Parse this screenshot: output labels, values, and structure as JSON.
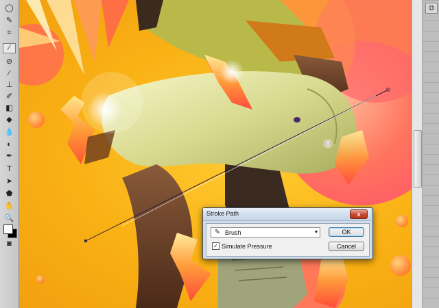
{
  "toolbar": {
    "tools": [
      {
        "id": "lasso",
        "icon": "lasso-icon",
        "glyph": "◯"
      },
      {
        "id": "quick-select",
        "icon": "magic-wand-icon",
        "glyph": "✎"
      },
      {
        "id": "crop",
        "icon": "crop-icon",
        "glyph": "⌗"
      },
      {
        "id": "eyedropper",
        "icon": "eyedropper-icon",
        "glyph": "⁄",
        "active": true
      },
      {
        "id": "healing",
        "icon": "bandage-icon",
        "glyph": "⊘"
      },
      {
        "id": "brush",
        "icon": "brush-icon",
        "glyph": "∕"
      },
      {
        "id": "clone",
        "icon": "stamp-icon",
        "glyph": "⊥"
      },
      {
        "id": "history",
        "icon": "history-brush-icon",
        "glyph": "✐"
      },
      {
        "id": "eraser",
        "icon": "eraser-icon",
        "glyph": "◧"
      },
      {
        "id": "bucket",
        "icon": "paint-bucket-icon",
        "glyph": "◆"
      },
      {
        "id": "blur",
        "icon": "drop-icon",
        "glyph": "💧"
      },
      {
        "id": "dodge",
        "icon": "dodge-icon",
        "glyph": "◐"
      },
      {
        "id": "pen",
        "icon": "pen-icon",
        "glyph": "✒"
      },
      {
        "id": "type",
        "icon": "type-icon",
        "glyph": "T"
      },
      {
        "id": "path-select",
        "icon": "arrow-icon",
        "glyph": "➤"
      },
      {
        "id": "shape",
        "icon": "shape-icon",
        "glyph": "⬟"
      },
      {
        "id": "hand",
        "icon": "hand-icon",
        "glyph": "✋"
      },
      {
        "id": "zoom",
        "icon": "zoom-icon",
        "glyph": "🔍"
      }
    ],
    "mode_icon": "quick-mask-icon"
  },
  "colors": {
    "foreground": "#ffffff",
    "background": "#000000",
    "canvas_base": "#f9b114",
    "dialog_title_bg": "#cfdcec",
    "close_button": "#c7452c"
  },
  "dialog": {
    "title": "Stroke Path",
    "close_label": "x",
    "tool_select": {
      "value": "Brush",
      "icon": "brush-icon"
    },
    "simulate_pressure": {
      "label": "Simulate Pressure",
      "checked": true,
      "mark": "✓"
    },
    "ok_label": "OK",
    "cancel_label": "Cancel"
  },
  "right_panel": {
    "icon": "panel-icon",
    "glyph": "⧉"
  }
}
